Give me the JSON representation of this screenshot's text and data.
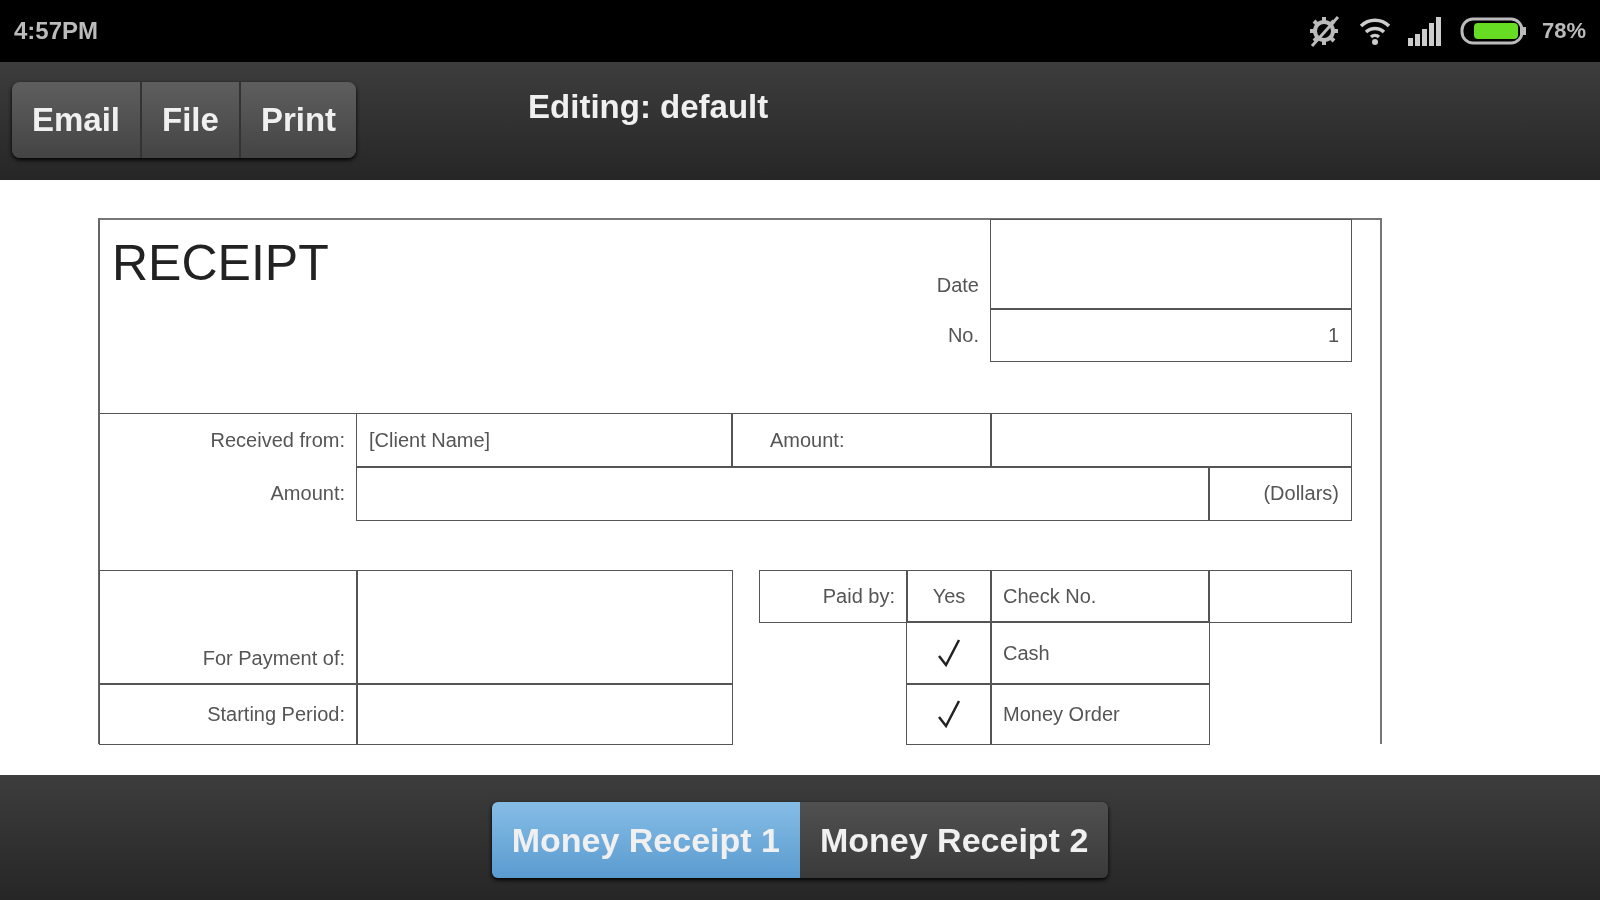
{
  "status_bar": {
    "time": "4:57PM",
    "battery": "78%"
  },
  "toolbar": {
    "buttons": [
      "Email",
      "File",
      "Print"
    ],
    "title": "Editing: default"
  },
  "receipt": {
    "title": "RECEIPT",
    "date_label": "Date",
    "no_label": "No.",
    "no_value": "1",
    "received_from_label": "Received from:",
    "received_from_value": "[Client Name]",
    "amount_label": "Amount:",
    "amount_words_label": "Amount:",
    "dollars_label": "(Dollars)",
    "for_payment_label": "For Payment of:",
    "starting_period_label": "Starting Period:",
    "paid_by_label": "Paid by:",
    "yes_header": "Yes",
    "check_no_label": "Check No.",
    "methods": [
      {
        "label": "Cash",
        "checked": true
      },
      {
        "label": "Money Order",
        "checked": true
      }
    ]
  },
  "tabs": [
    {
      "label": "Money Receipt 1",
      "selected": true
    },
    {
      "label": "Money Receipt 2",
      "selected": false
    }
  ]
}
